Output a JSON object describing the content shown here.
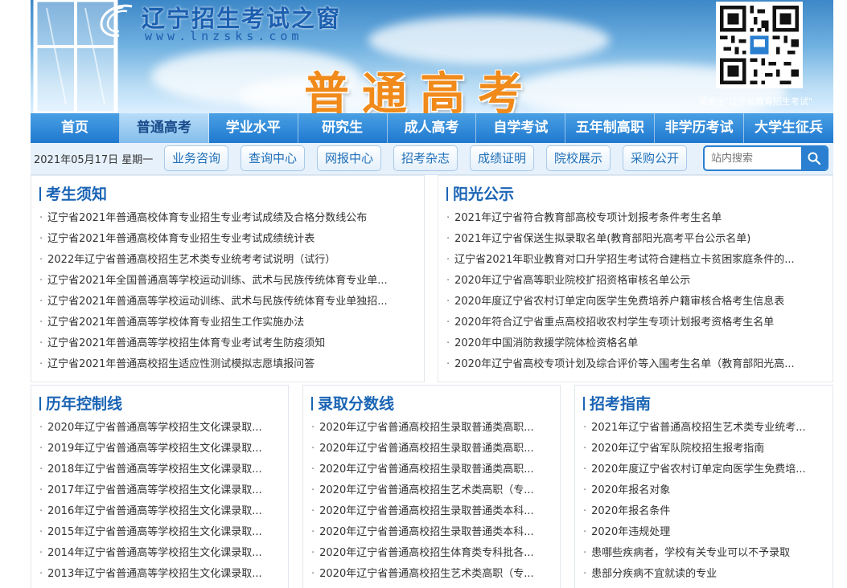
{
  "banner": {
    "site_name": "辽宁招生考试之窗",
    "site_url": "www.lnzsks.com",
    "section_title": "普通高考",
    "qr_caption": "请关注\"辽宁省教育招生考试\""
  },
  "nav": {
    "items": [
      {
        "label": "首页"
      },
      {
        "label": "普通高考"
      },
      {
        "label": "学业水平"
      },
      {
        "label": "研究生"
      },
      {
        "label": "成人高考"
      },
      {
        "label": "自学考试"
      },
      {
        "label": "五年制高职"
      },
      {
        "label": "非学历考试"
      },
      {
        "label": "大学生征兵"
      }
    ],
    "active_index": 1
  },
  "subbar": {
    "date": "2021年05月17日 星期一",
    "quick_links": [
      {
        "label": "业务咨询"
      },
      {
        "label": "查询中心"
      },
      {
        "label": "网报中心"
      },
      {
        "label": "招考杂志"
      },
      {
        "label": "成绩证明"
      },
      {
        "label": "院校展示"
      },
      {
        "label": "采购公开"
      }
    ],
    "search_placeholder": "站内搜索"
  },
  "panels": {
    "notice": {
      "title": "考生须知",
      "items": [
        "辽宁省2021年普通高校体育专业招生专业考试成绩及合格分数线公布",
        "辽宁省2021年普通高校体育专业招生专业考试成绩统计表",
        "2022年辽宁省普通高校招生艺术类专业统考考试说明（试行）",
        "辽宁省2021年全国普通高等学校运动训练、武术与民族传统体育专业单...",
        "辽宁省2021年普通高等学校运动训练、武术与民族传统体育专业单独招...",
        "辽宁省2021年普通高等学校体育专业招生工作实施办法",
        "辽宁省2021年普通高等学校招生体育专业考试考生防疫须知",
        "辽宁省2021年普通高校招生适应性测试模拟志愿填报问答"
      ]
    },
    "sunshine": {
      "title": "阳光公示",
      "items": [
        "2021年辽宁省符合教育部高校专项计划报考条件考生名单",
        "2021年辽宁省保送生拟录取名单(教育部阳光高考平台公示名单)",
        "辽宁省2021年职业教育对口升学招生考试符合建档立卡贫困家庭条件的...",
        "2020年辽宁省高等职业院校扩招资格审核名单公示",
        "2020年度辽宁省农村订单定向医学生免费培养户籍审核合格考生信息表",
        "2020年符合辽宁省重点高校招收农村学生专项计划报考资格考生名单",
        "2020年中国消防救援学院体检资格名单",
        "2020年辽宁省高校专项计划及综合评价等入围考生名单（教育部阳光高..."
      ]
    },
    "history": {
      "title": "历年控制线",
      "items": [
        "2020年辽宁省普通高等学校招生文化课录取...",
        "2019年辽宁省普通高等学校招生文化课录取...",
        "2018年辽宁省普通高等学校招生文化课录取...",
        "2017年辽宁省普通高等学校招生文化课录取...",
        "2016年辽宁省普通高等学校招生文化课录取...",
        "2015年辽宁省普通高等学校招生文化课录取...",
        "2014年辽宁省普通高等学校招生文化课录取...",
        "2013年辽宁省普通高等学校招生文化课录取..."
      ]
    },
    "scores": {
      "title": "录取分数线",
      "items": [
        "2020年辽宁省普通高校招生录取普通类高职...",
        "2020年辽宁省普通高校招生录取普通类高职...",
        "2020年辽宁省普通高校招生录取普通类高职...",
        "2020年辽宁省普通高校招生艺术类高职（专...",
        "2020年辽宁省普通高校招生录取普通类本科...",
        "2020年辽宁省普通高校招生录取普通类本科...",
        "2020年辽宁省普通高校招生体育类专科批各...",
        "2020年辽宁省普通高校招生艺术类高职（专..."
      ]
    },
    "guide": {
      "title": "招考指南",
      "items": [
        "2021年辽宁省普通高校招生艺术类专业统考...",
        "2020年辽宁省军队院校招生报考指南",
        "2020年度辽宁省农村订单定向医学生免费培...",
        "2020年报名对象",
        "2020年报名条件",
        "2020年违规处理",
        "患哪些疾病者，学校有关专业可以不予录取",
        "患部分疾病不宜就读的专业"
      ]
    }
  },
  "colors": {
    "nav_bg": "#1f78cf",
    "nav_active_bg": "#9ccbf0",
    "title_blue": "#1a64b4",
    "accent_orange": "#f08a1a"
  }
}
